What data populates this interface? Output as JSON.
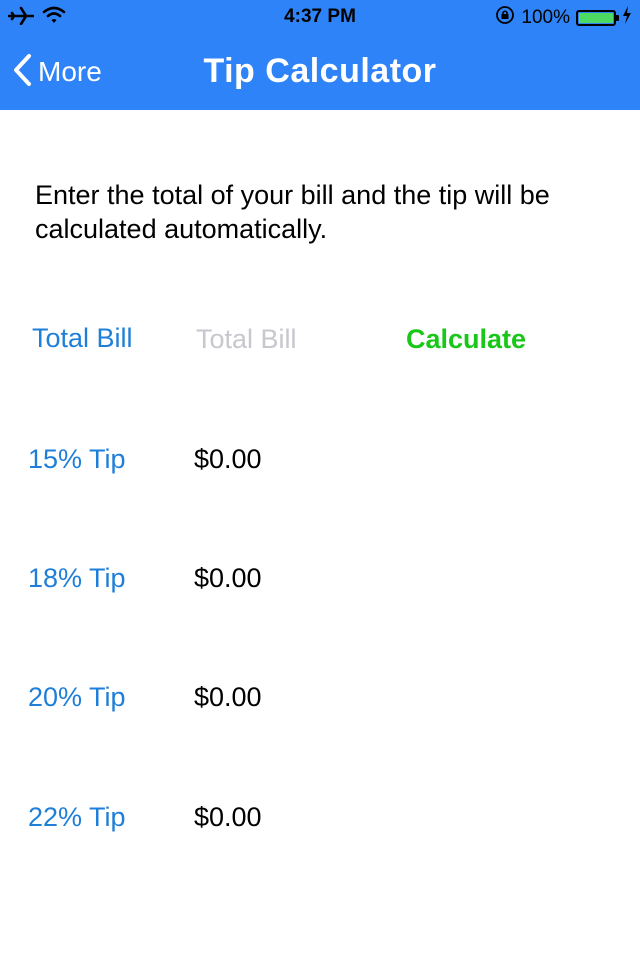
{
  "status_bar": {
    "time": "4:37 PM",
    "battery_percent": "100%",
    "battery_level": 1.0,
    "icons": [
      "airplane-icon",
      "wifi-icon",
      "orientation-lock-icon",
      "battery-icon",
      "charging-bolt-icon"
    ]
  },
  "nav": {
    "back_label": "More",
    "title": "Tip Calculator",
    "background_color": "#2e83f8"
  },
  "instructions": "Enter the total of your bill and the tip will be calculated automatically.",
  "bill": {
    "label": "Total Bill",
    "value": "",
    "placeholder": "Total Bill",
    "calculate_label": "Calculate"
  },
  "tips": [
    {
      "label": "15% Tip",
      "amount": "$0.00"
    },
    {
      "label": "18% Tip",
      "amount": "$0.00"
    },
    {
      "label": "20% Tip",
      "amount": "$0.00"
    },
    {
      "label": "22% Tip",
      "amount": "$0.00"
    }
  ],
  "colors": {
    "accent_blue": "#1f7fd8",
    "calculate_green": "#18c718",
    "placeholder_gray": "#c7c7cd"
  }
}
